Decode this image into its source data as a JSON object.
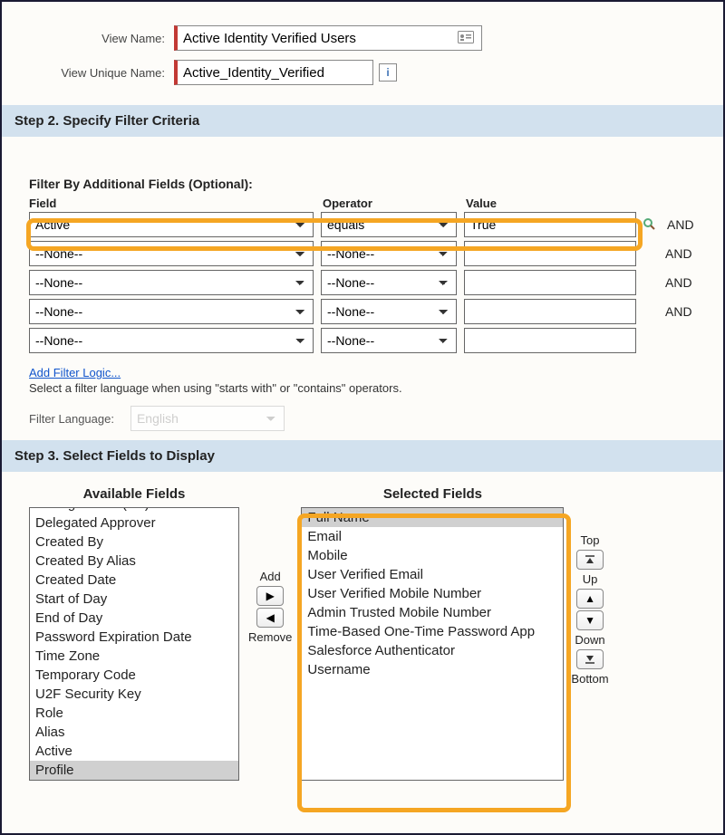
{
  "labels": {
    "view_name": "View Name:",
    "view_unique_name": "View Unique Name:"
  },
  "view_name": "Active Identity Verified Users",
  "view_unique_name": "Active_Identity_Verified",
  "step2": {
    "title": "Step 2. Specify Filter Criteria",
    "filter_by_heading": "Filter By Additional Fields (Optional):",
    "col_field": "Field",
    "col_operator": "Operator",
    "col_value": "Value",
    "and": "AND",
    "rows": [
      {
        "field": "Active",
        "operator": "equals",
        "value": "True"
      },
      {
        "field": "--None--",
        "operator": "--None--",
        "value": ""
      },
      {
        "field": "--None--",
        "operator": "--None--",
        "value": ""
      },
      {
        "field": "--None--",
        "operator": "--None--",
        "value": ""
      },
      {
        "field": "--None--",
        "operator": "--None--",
        "value": ""
      }
    ],
    "add_filter_logic": "Add Filter Logic...",
    "hint": "Select a filter language when using \"starts with\" or \"contains\" operators.",
    "filter_language_label": "Filter Language:",
    "filter_language_value": "English"
  },
  "step3": {
    "title": "Step 3. Select Fields to Display",
    "available_header": "Available Fields",
    "selected_header": "Selected Fields",
    "add_label": "Add",
    "remove_label": "Remove",
    "top": "Top",
    "up": "Up",
    "down": "Down",
    "bottom": "Bottom",
    "available": [
      "Storage Used (KB)",
      "Delegated Approver",
      "Created By",
      "Created By Alias",
      "Created Date",
      "Start of Day",
      "End of Day",
      "Password Expiration Date",
      "Time Zone",
      "Temporary Code",
      "U2F Security Key",
      "Role",
      "Alias",
      "Active",
      "Profile"
    ],
    "available_selected": "Profile",
    "selected": [
      "Full Name",
      "Email",
      "Mobile",
      "User Verified Email",
      "User Verified Mobile Number",
      "Admin Trusted Mobile Number",
      "Time-Based One-Time Password App",
      "Salesforce Authenticator",
      "Username"
    ],
    "selected_selected": "Full Name"
  }
}
